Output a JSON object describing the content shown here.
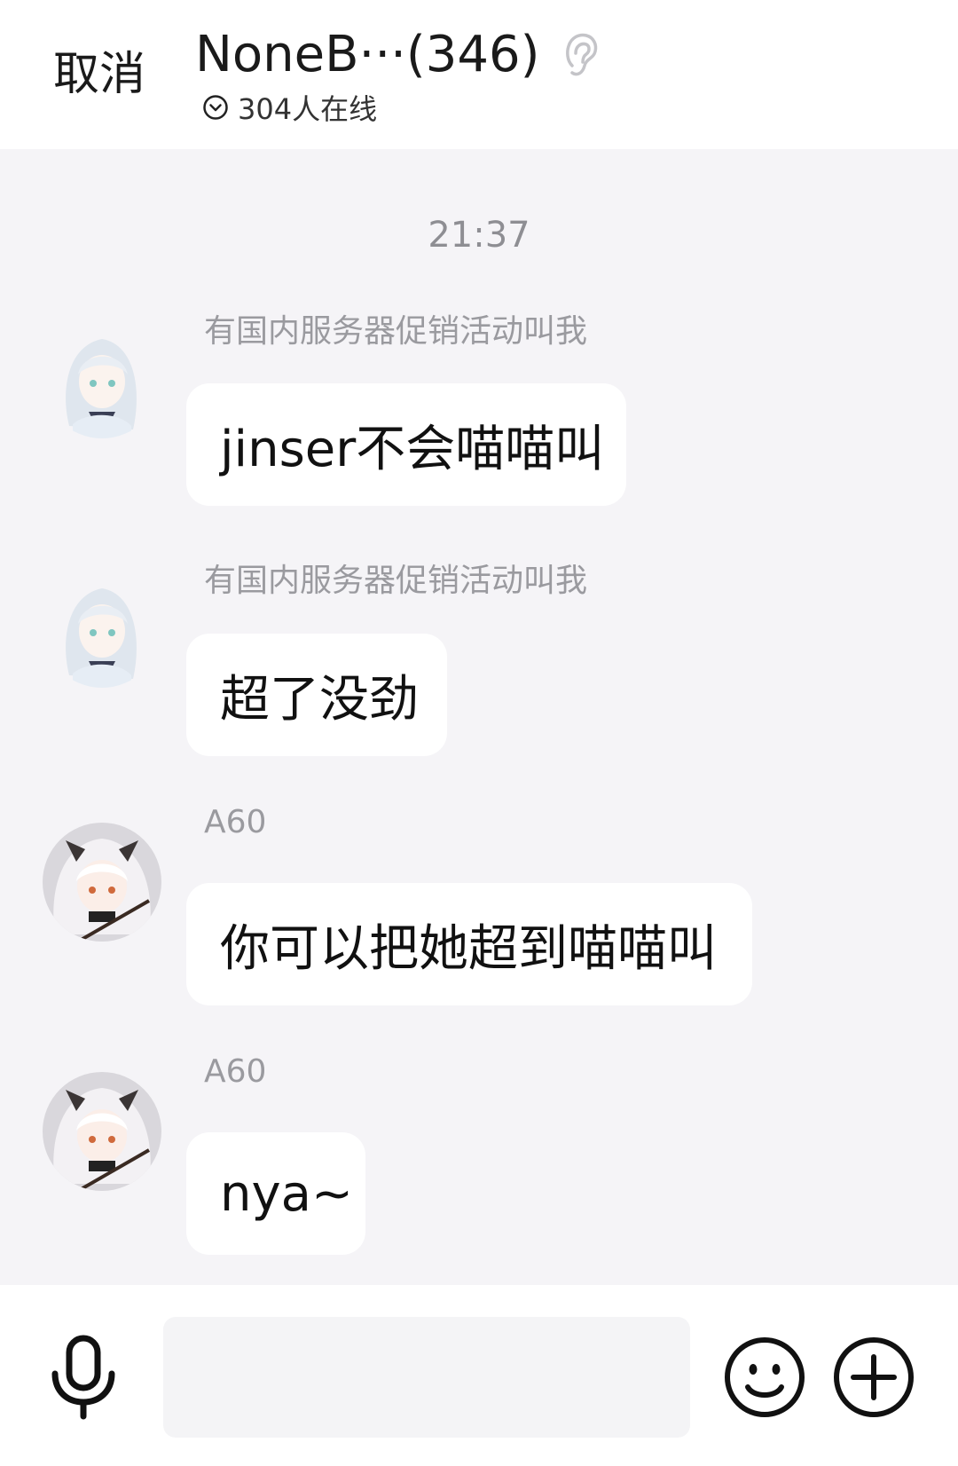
{
  "header": {
    "cancel_label": "取消",
    "group_title": "NoneB···(346)",
    "online_text": "304人在线",
    "icons": [
      "ear-icon",
      "chevron-circle-icon"
    ]
  },
  "chat": {
    "timestamp": "21:37",
    "messages": [
      {
        "sender": "有国内服务器促销活动叫我",
        "text": "jinser不会喵喵叫",
        "avatar": "anime-avatar-white-hair"
      },
      {
        "sender": "有国内服务器促销活动叫我",
        "text": "超了没劲",
        "avatar": "anime-avatar-white-hair"
      },
      {
        "sender": "A60",
        "text": "你可以把她超到喵喵叫",
        "avatar": "anime-avatar-horned"
      },
      {
        "sender": "A60",
        "text": "nya~",
        "avatar": "anime-avatar-horned"
      }
    ]
  },
  "bottom_bar": {
    "input_value": "",
    "icons": [
      "microphone-icon",
      "emoji-icon",
      "plus-circle-icon"
    ]
  },
  "colors": {
    "chat_background": "#f5f4f7",
    "bubble": "#ffffff",
    "secondary_text": "#9a9a9f"
  }
}
